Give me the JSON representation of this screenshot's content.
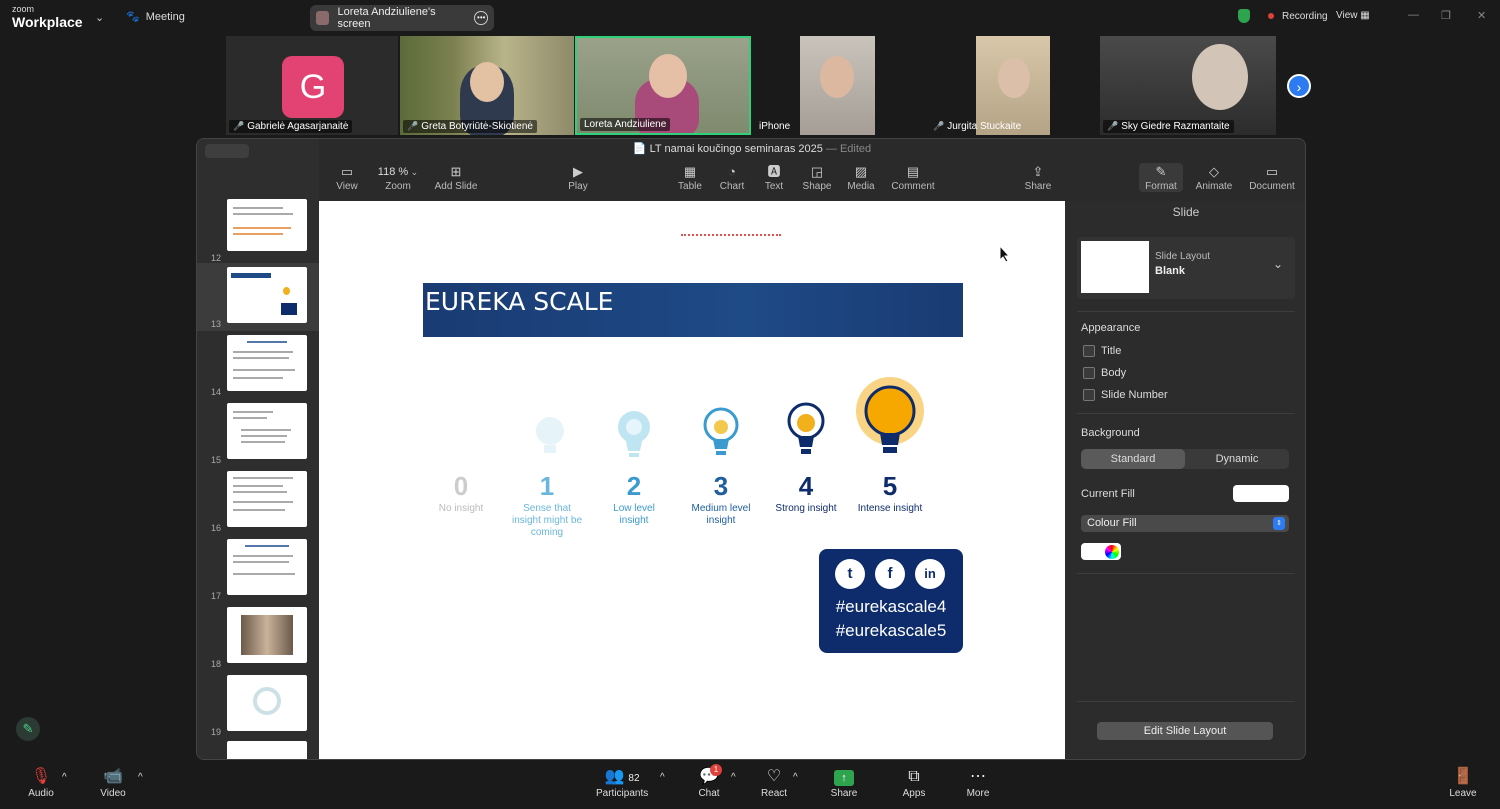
{
  "topbar": {
    "brand_small": "zoom",
    "brand_large": "Workplace",
    "meeting_label": "Meeting",
    "share_title": "Loreta Andziuliene's screen",
    "recording_label": "Recording",
    "view_label": "View"
  },
  "participants": [
    {
      "name": "Gabrielė Agasarjanaitė",
      "initial": "G",
      "muted": true
    },
    {
      "name": "Greta Botyriūtė-Skiotienė",
      "muted": true
    },
    {
      "name": "Loreta Andziuliene",
      "muted": false
    },
    {
      "name": "iPhone",
      "muted": false
    },
    {
      "name": "Jurgita Stuckaite",
      "muted": true
    },
    {
      "name": "Sky Giedre Razmantaite",
      "muted": true
    }
  ],
  "keynote": {
    "doc_title": "LT namai koučingo seminaras 2025",
    "doc_status": "Edited",
    "toolbar": {
      "view": "View",
      "zoom_value": "118 %",
      "zoom": "Zoom",
      "add_slide": "Add Slide",
      "play": "Play",
      "table": "Table",
      "chart": "Chart",
      "text": "Text",
      "shape": "Shape",
      "media": "Media",
      "comment": "Comment",
      "share": "Share",
      "format": "Format",
      "animate": "Animate",
      "document": "Document"
    },
    "slide_numbers": [
      "12",
      "13",
      "14",
      "15",
      "16",
      "17",
      "18",
      "19"
    ],
    "slide": {
      "title": "EUREKA SCALE",
      "levels": [
        {
          "num": "0",
          "label": "No insight"
        },
        {
          "num": "1",
          "label": "Sense that insight might be coming"
        },
        {
          "num": "2",
          "label": "Low level insight"
        },
        {
          "num": "3",
          "label": "Medium level insight"
        },
        {
          "num": "4",
          "label": "Strong insight"
        },
        {
          "num": "5",
          "label": "Intense insight"
        }
      ],
      "hashtag1": "#eurekascale4",
      "hashtag2": "#eurekascale5"
    },
    "inspector": {
      "header": "Slide",
      "layout_label": "Slide Layout",
      "layout_value": "Blank",
      "appearance": "Appearance",
      "chk_title": "Title",
      "chk_body": "Body",
      "chk_slide_number": "Slide Number",
      "background": "Background",
      "seg_standard": "Standard",
      "seg_dynamic": "Dynamic",
      "current_fill": "Current Fill",
      "colour_fill": "Colour Fill",
      "edit_layout": "Edit Slide Layout"
    }
  },
  "bottombar": {
    "audio": "Audio",
    "video": "Video",
    "participants_count": "82",
    "participants": "Participants",
    "chat": "Chat",
    "chat_badge": "1",
    "react": "React",
    "share": "Share",
    "apps": "Apps",
    "more": "More",
    "leave": "Leave"
  }
}
